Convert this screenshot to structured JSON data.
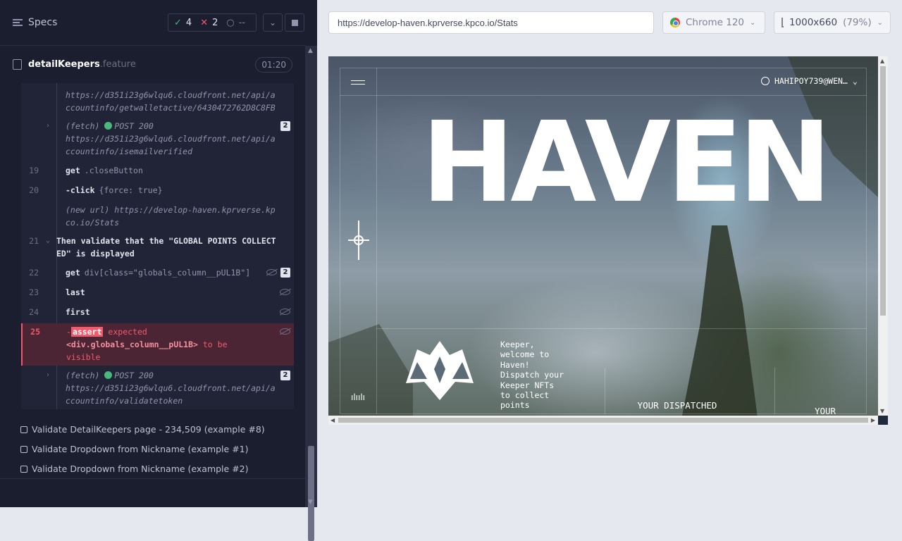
{
  "reporter": {
    "title": "Specs",
    "stats": {
      "passed": "4",
      "failed": "2",
      "pending": "--"
    },
    "file": {
      "name": "detailKeepers",
      "ext": ".feature",
      "duration": "01:20"
    },
    "log": [
      {
        "url": "https://d351i23g6wlqu6.cloudfront.net/api/accountinfo/getwalletactive/6430472762D8C8FB"
      },
      {
        "label": "(fetch)",
        "status": "POST 200",
        "url": "https://d351i23g6wlqu6.cloudfront.net/api/accountinfo/isemailverified",
        "count": "2"
      },
      {
        "num": "19",
        "cmd": "get",
        "arg": ".closeButton"
      },
      {
        "num": "20",
        "cmd": "-click",
        "arg": "{force: true}"
      },
      {
        "label": "(new url)",
        "url": "https://develop-haven.kprverse.kpco.io/Stats"
      },
      {
        "num": "21",
        "cmd": "Then",
        "arg": "validate that the \"GLOBAL POINTS COLLECTED\" is displayed"
      },
      {
        "num": "22",
        "cmd": "get",
        "arg": "div[class=\"globals_column__pUL1B\"]",
        "count": "2"
      },
      {
        "num": "23",
        "cmd": "last"
      },
      {
        "num": "24",
        "cmd": "first"
      },
      {
        "num": "25",
        "cmd": "assert",
        "expected": "expected",
        "value": "<div.globals_column__pUL1B>",
        "tail": "to be",
        "tail2": "visible"
      },
      {
        "label": "(fetch)",
        "status": "POST 200",
        "url": "https://d351i23g6wlqu6.cloudfront.net/api/accountinfo/validatetoken",
        "count": "2"
      }
    ],
    "specs": [
      "Validate DetailKeepers page - 234,509 (example #8)",
      "Validate Dropdown from Nickname (example #1)",
      "Validate Dropdown from Nickname (example #2)"
    ]
  },
  "browser": {
    "url": "https://develop-haven.kprverse.kpco.io/Stats",
    "name": "Chrome 120",
    "viewport": "1000x660",
    "zoom": "(79%)"
  },
  "app": {
    "logo": "HAVEN",
    "user": "HAHIPOY739@WEN…",
    "welcome": "Keeper, welcome to Haven! Dispatch your Keeper NFTs to collect points",
    "col1": "YOUR DISPATCHED",
    "col2": "YOUR"
  },
  "colors": {
    "pass": "#48b87d",
    "fail": "#f05a6c",
    "panel": "#1b1e2e"
  }
}
